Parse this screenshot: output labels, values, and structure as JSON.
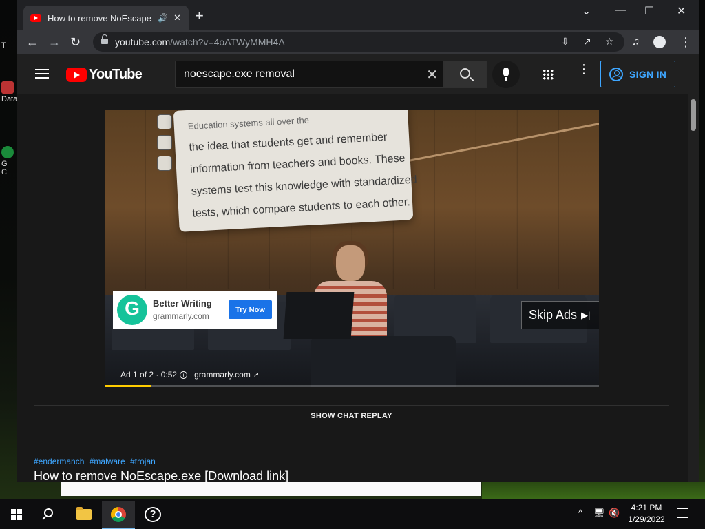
{
  "desktop": {
    "icons": [
      {
        "label": "T"
      },
      {
        "label": "Data"
      },
      {
        "label": "G"
      },
      {
        "label": "C"
      }
    ]
  },
  "browser": {
    "tab": {
      "title": "How to remove NoEscape.exe",
      "audio_icon": "speaker-icon",
      "close_glyph": "✕"
    },
    "new_tab_glyph": "+",
    "window_controls": {
      "dropdown": "⌄",
      "minimize": "—",
      "maximize": "☐",
      "close": "✕"
    },
    "nav": {
      "back": "←",
      "forward": "→",
      "reload": "↻"
    },
    "address": {
      "host": "youtube.com",
      "path": "/watch?v=4oATWyMMH4A"
    }
  },
  "youtube": {
    "logo_text": "YouTube",
    "search": {
      "query": "noescape.exe removal",
      "clear_glyph": "✕"
    },
    "signin_label": "SIGN IN",
    "more_glyph": "⋮"
  },
  "video": {
    "overlay_lines": [
      "Education systems all over the",
      "the idea that students get and remember",
      "information from teachers and books. These",
      "systems test this knowledge with standardized",
      "tests, which compare students to each other."
    ],
    "ad_card": {
      "title": "Better Writing",
      "domain": "grammarly.com",
      "cta": "Try Now"
    },
    "skip_label": "Skip Ads",
    "skip_glyph": "▶|",
    "ad_meta": {
      "text": "Ad 1 of 2 · 0:52",
      "info": "i",
      "link": "grammarly.com",
      "ext": "↗"
    },
    "progress": 0.095
  },
  "page": {
    "chat_replay_label": "SHOW CHAT REPLAY",
    "hashtags": [
      "#endermanch",
      "#malware",
      "#trojan"
    ],
    "title": "How to remove NoEscape.exe [Download link]"
  },
  "taskbar": {
    "tray": {
      "chevron": "^"
    },
    "time": "4:21 PM",
    "date": "1/29/2022"
  },
  "colors": {
    "yt_red": "#ff0000",
    "accent_blue": "#3ea6ff",
    "progress_yellow": "#ffcc00",
    "grammarly_green": "#15c39a"
  }
}
